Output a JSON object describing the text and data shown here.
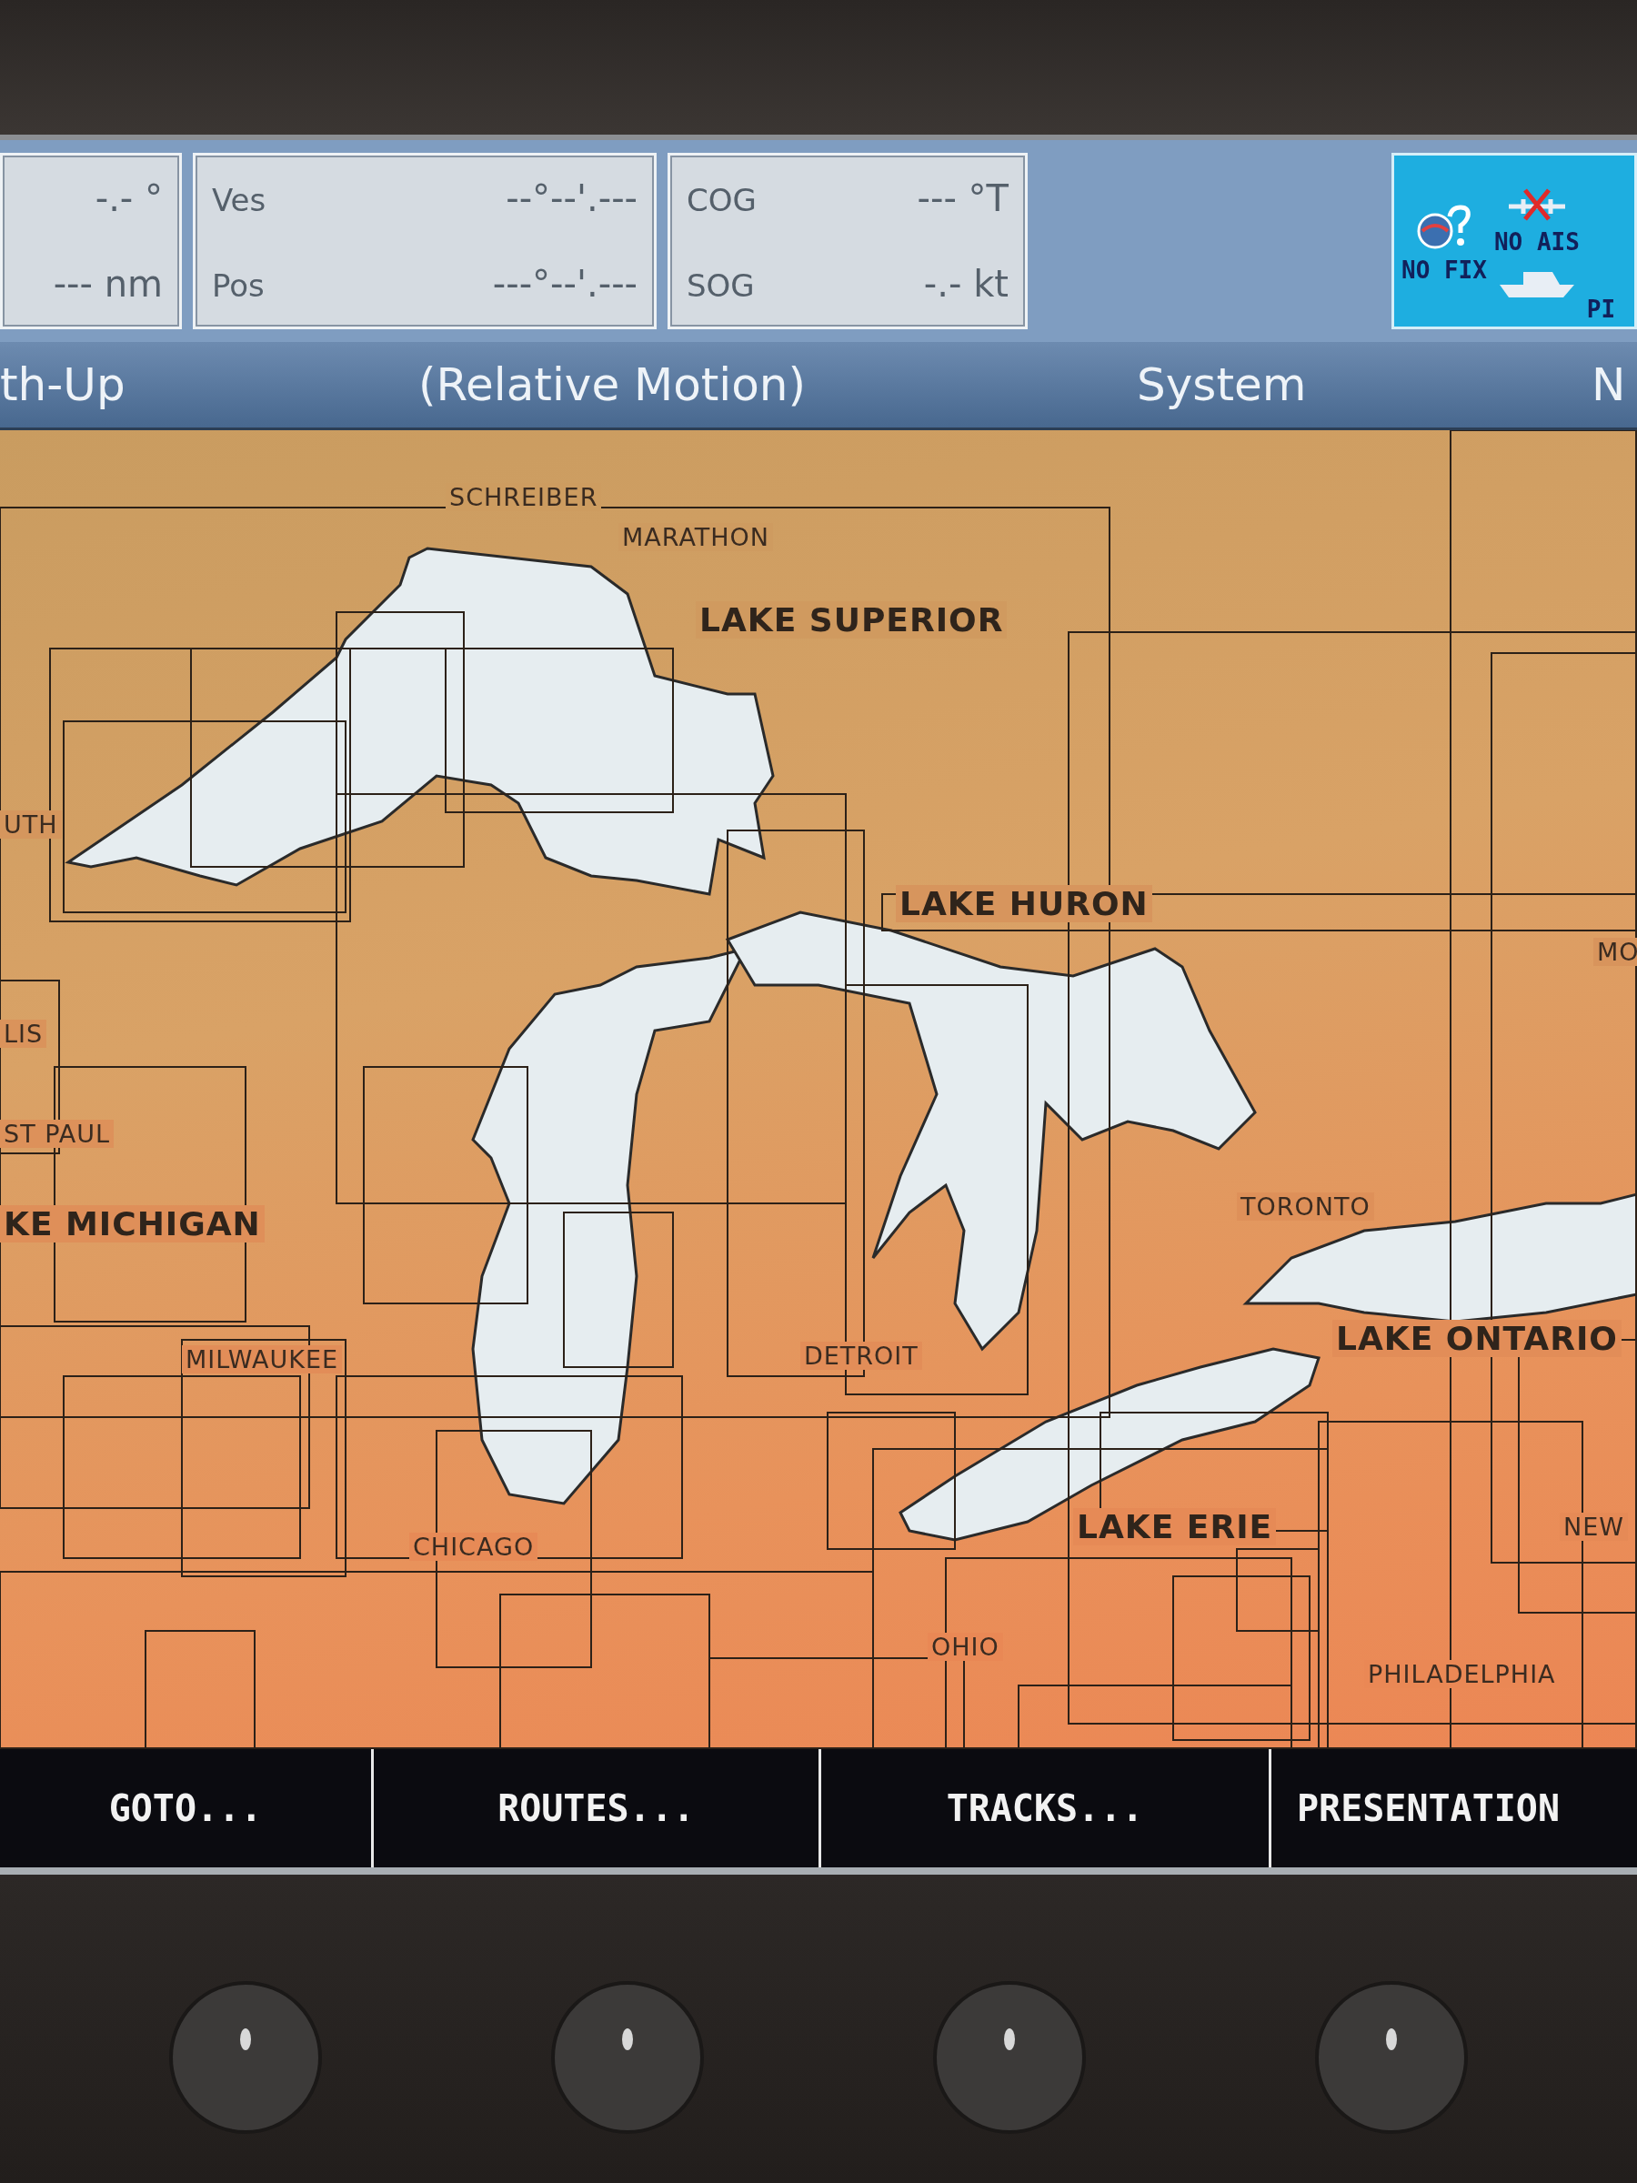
{
  "data_bar": {
    "cells": [
      {
        "rows": [
          {
            "value": "-.- °"
          },
          {
            "value": "--- nm"
          }
        ]
      },
      {
        "rows": [
          {
            "label": "Ves",
            "value": "--°--'.---"
          },
          {
            "label": "Pos",
            "value": "---°--'.---"
          }
        ]
      },
      {
        "rows": [
          {
            "label": "COG",
            "value": "--- °T"
          },
          {
            "label": "SOG",
            "value": "-.- kt"
          }
        ]
      }
    ]
  },
  "status": {
    "gps": "NO FIX",
    "ais": "NO AIS",
    "other": "PI"
  },
  "mode_bar": [
    "th-Up",
    "(Relative Motion)",
    "System",
    "N"
  ],
  "map": {
    "labels": [
      {
        "text": "SCHREIBER",
        "kind": "place"
      },
      {
        "text": "MARATHON",
        "kind": "place"
      },
      {
        "text": "LAKE SUPERIOR",
        "kind": "lake"
      },
      {
        "text": "UTH",
        "kind": "place"
      },
      {
        "text": "LAKE HURON",
        "kind": "lake"
      },
      {
        "text": "MO",
        "kind": "place"
      },
      {
        "text": "LIS",
        "kind": "place"
      },
      {
        "text": "ST PAUL",
        "kind": "place"
      },
      {
        "text": "KE MICHIGAN",
        "kind": "lake"
      },
      {
        "text": "TORONTO",
        "kind": "place"
      },
      {
        "text": "MILWAUKEE",
        "kind": "place"
      },
      {
        "text": "DETROIT",
        "kind": "place"
      },
      {
        "text": "LAKE ONTARIO",
        "kind": "lake"
      },
      {
        "text": "NEW",
        "kind": "place"
      },
      {
        "text": "CHICAGO",
        "kind": "place"
      },
      {
        "text": "LAKE ERIE",
        "kind": "lake"
      },
      {
        "text": "OHIO",
        "kind": "place"
      },
      {
        "text": "PHILADELPHIA",
        "kind": "place"
      }
    ]
  },
  "softkeys": [
    "GOTO...",
    "ROUTES...",
    "TRACKS...",
    "PRESENTATION"
  ]
}
